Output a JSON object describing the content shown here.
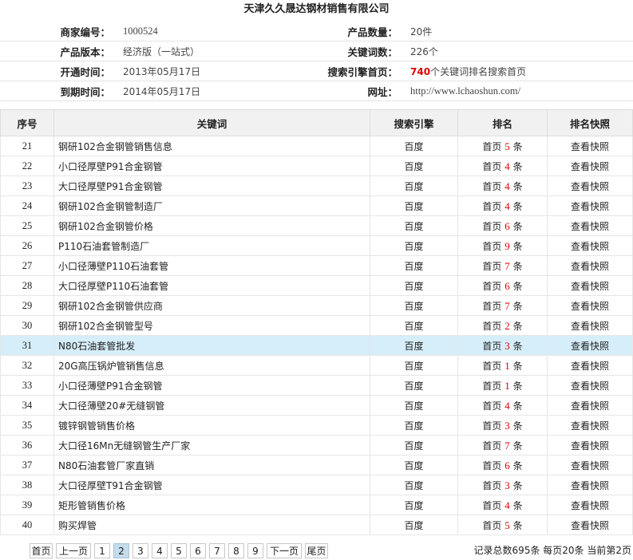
{
  "title": "天津久久晟达钢材销售有限公司",
  "info": {
    "merchant_id_label": "商家编号：",
    "merchant_id": "1000524",
    "product_count_label": "产品数量：",
    "product_count": "20件",
    "version_label": "产品版本：",
    "version": "经济版（一站式）",
    "keyword_count_label": "关键词数：",
    "keyword_count": "226个",
    "open_label": "开通时间：",
    "open_time": "2013年05月17日",
    "se_label": "搜索引擎首页：",
    "se_num": "740",
    "se_text": "个关键词排名搜索首页",
    "expire_label": "到期时间：",
    "expire_time": "2014年05月17日",
    "site_label": "网址：",
    "site_url": "http://www.lchaoshun.com/"
  },
  "table": {
    "headers": [
      "序号",
      "关键词",
      "搜索引擎",
      "排名",
      "排名快照"
    ],
    "rows": [
      {
        "id": "21",
        "kw": "钢研102合金钢管销售信息",
        "se": "百度",
        "rank_pre": "首页",
        "rank_num": "5",
        "rank_post": "条",
        "snap": "查看快照"
      },
      {
        "id": "22",
        "kw": "小口径厚壁P91合金钢管",
        "se": "百度",
        "rank_pre": "首页",
        "rank_num": "4",
        "rank_post": "条",
        "snap": "查看快照"
      },
      {
        "id": "23",
        "kw": "大口径厚壁P91合金钢管",
        "se": "百度",
        "rank_pre": "首页",
        "rank_num": "4",
        "rank_post": "条",
        "snap": "查看快照"
      },
      {
        "id": "24",
        "kw": "钢研102合金钢管制造厂",
        "se": "百度",
        "rank_pre": "首页",
        "rank_num": "4",
        "rank_post": "条",
        "snap": "查看快照"
      },
      {
        "id": "25",
        "kw": "钢研102合金钢管价格",
        "se": "百度",
        "rank_pre": "首页",
        "rank_num": "6",
        "rank_post": "条",
        "snap": "查看快照"
      },
      {
        "id": "26",
        "kw": "P110石油套管制造厂",
        "se": "百度",
        "rank_pre": "首页",
        "rank_num": "9",
        "rank_post": "条",
        "snap": "查看快照"
      },
      {
        "id": "27",
        "kw": "小口径薄壁P110石油套管",
        "se": "百度",
        "rank_pre": "首页",
        "rank_num": "7",
        "rank_post": "条",
        "snap": "查看快照"
      },
      {
        "id": "28",
        "kw": "大口径厚壁P110石油套管",
        "se": "百度",
        "rank_pre": "首页",
        "rank_num": "6",
        "rank_post": "条",
        "snap": "查看快照"
      },
      {
        "id": "29",
        "kw": "钢研102合金钢管供应商",
        "se": "百度",
        "rank_pre": "首页",
        "rank_num": "7",
        "rank_post": "条",
        "snap": "查看快照"
      },
      {
        "id": "30",
        "kw": "钢研102合金钢管型号",
        "se": "百度",
        "rank_pre": "首页",
        "rank_num": "2",
        "rank_post": "条",
        "snap": "查看快照"
      },
      {
        "id": "31",
        "kw": "N80石油套管批发",
        "se": "百度",
        "rank_pre": "首页",
        "rank_num": "3",
        "rank_post": "条",
        "snap": "查看快照"
      },
      {
        "id": "32",
        "kw": "20G高压锅炉管销售信息",
        "se": "百度",
        "rank_pre": "首页",
        "rank_num": "1",
        "rank_post": "条",
        "snap": "查看快照"
      },
      {
        "id": "33",
        "kw": "小口径薄壁P91合金钢管",
        "se": "百度",
        "rank_pre": "首页",
        "rank_num": "1",
        "rank_post": "条",
        "snap": "查看快照"
      },
      {
        "id": "34",
        "kw": "大口径薄壁20#无缝钢管",
        "se": "百度",
        "rank_pre": "首页",
        "rank_num": "4",
        "rank_post": "条",
        "snap": "查看快照"
      },
      {
        "id": "35",
        "kw": "镀锌钢管销售价格",
        "se": "百度",
        "rank_pre": "首页",
        "rank_num": "3",
        "rank_post": "条",
        "snap": "查看快照"
      },
      {
        "id": "36",
        "kw": "大口径16Mn无缝钢管生产厂家",
        "se": "百度",
        "rank_pre": "首页",
        "rank_num": "7",
        "rank_post": "条",
        "snap": "查看快照"
      },
      {
        "id": "37",
        "kw": "N80石油套管厂家直销",
        "se": "百度",
        "rank_pre": "首页",
        "rank_num": "6",
        "rank_post": "条",
        "snap": "查看快照"
      },
      {
        "id": "38",
        "kw": "大口径厚壁T91合金钢管",
        "se": "百度",
        "rank_pre": "首页",
        "rank_num": "3",
        "rank_post": "条",
        "snap": "查看快照"
      },
      {
        "id": "39",
        "kw": "矩形管销售价格",
        "se": "百度",
        "rank_pre": "首页",
        "rank_num": "4",
        "rank_post": "条",
        "snap": "查看快照"
      },
      {
        "id": "40",
        "kw": "购买焊管",
        "se": "百度",
        "rank_pre": "首页",
        "rank_num": "5",
        "rank_post": "条",
        "snap": "查看快照"
      }
    ],
    "highlighted_row_id": "31"
  },
  "pager": {
    "first": "首页",
    "prev": "上一页",
    "pages": [
      "1",
      "2",
      "3",
      "4",
      "5",
      "6",
      "7",
      "8",
      "9"
    ],
    "current": "2",
    "next": "下一页",
    "last": "尾页",
    "summary": "记录总数695条 每页20条 当前第2页"
  },
  "colors": {
    "accent_red": "#e00000",
    "highlight_row": "#d6eefa",
    "current_page": "#c5dcec"
  }
}
